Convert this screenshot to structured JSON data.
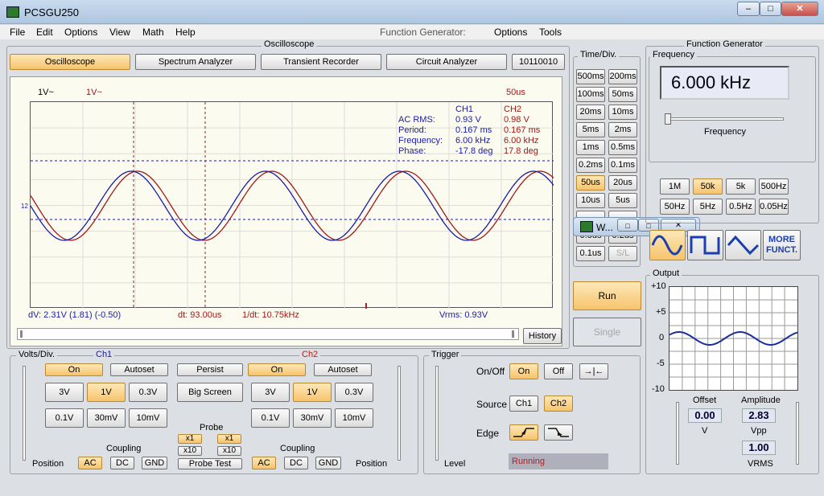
{
  "window": {
    "title": "PCSGU250",
    "minimize": "‒",
    "maximize": "□",
    "close": "✕"
  },
  "menu": {
    "file": "File",
    "edit": "Edit",
    "options": "Options",
    "view": "View",
    "math": "Math",
    "help": "Help",
    "fg_label": "Function Generator:",
    "fg_options": "Options",
    "fg_tools": "Tools"
  },
  "osc": {
    "section_title": "Oscilloscope",
    "tabs": [
      "Oscilloscope",
      "Spectrum Analyzer",
      "Transient Recorder",
      "Circuit Analyzer",
      "10110010"
    ]
  },
  "scope": {
    "ch1_scale": "1V~",
    "ch2_scale": "1V~",
    "timebase": "50us",
    "marker": "12",
    "meas_headers": [
      "CH1",
      "CH2"
    ],
    "meas": [
      {
        "label": "AC RMS:",
        "ch1": "0.93 V",
        "ch2": "0.98 V"
      },
      {
        "label": "Period:",
        "ch1": "0.167 ms",
        "ch2": "0.167 ms"
      },
      {
        "label": "Frequency:",
        "ch1": "6.00 kHz",
        "ch2": "6.00 kHz"
      },
      {
        "label": "Phase:",
        "ch1": "-17.8 deg",
        "ch2": "17.8 deg"
      }
    ],
    "dv": "dV: 2.31V  (1.81) (-0.50)",
    "dt": "dt: 93.00us",
    "inv_dt": "1/dt: 10.75kHz",
    "vrms": "Vrms: 0.93V",
    "history": "History",
    "colors": {
      "ch1": "#1a1aa8",
      "ch2": "#a01818"
    }
  },
  "timediv": {
    "title": "Time/Div.",
    "buttons": [
      [
        "500ms",
        "200ms"
      ],
      [
        "100ms",
        "50ms"
      ],
      [
        "20ms",
        "10ms"
      ],
      [
        "5ms",
        "2ms"
      ],
      [
        "1ms",
        "0.5ms"
      ],
      [
        "0.2ms",
        "0.1ms"
      ],
      [
        "50us",
        "20us"
      ],
      [
        "10us",
        "5us"
      ],
      [
        "",
        ""
      ],
      [
        "0.5us",
        "0.2us"
      ],
      [
        "0.1us",
        "S/L"
      ]
    ],
    "selected": "50us"
  },
  "run": "Run",
  "single": "Single",
  "mini_window": {
    "title": "W..."
  },
  "fg": {
    "title": "Function Generator",
    "freq_label": "Frequency",
    "freq_value": "6.000 kHz",
    "slider_label": "Frequency",
    "ranges": [
      "1M",
      "50k",
      "5k",
      "500Hz",
      "50Hz",
      "5Hz",
      "0.5Hz",
      "0.05Hz"
    ],
    "range_selected": "50k",
    "more": "MORE FUNCT.",
    "output_label": "Output",
    "y_ticks": [
      "+10",
      "+5",
      "0",
      "-5",
      "-10"
    ],
    "offset_label": "Offset",
    "offset_value": "0.00",
    "offset_unit": "V",
    "amp_label": "Amplitude",
    "amp_value": "2.83",
    "amp_unit": "Vpp",
    "vrms_value": "1.00",
    "vrms_unit": "VRMS"
  },
  "volts": {
    "title": "Volts/Div.",
    "ch1": "Ch1",
    "ch2": "Ch2",
    "on": "On",
    "autoset": "Autoset",
    "persist": "Persist",
    "big_screen": "Big Screen",
    "row1": [
      "3V",
      "1V",
      "0.3V"
    ],
    "row2": [
      "0.1V",
      "30mV",
      "10mV"
    ],
    "selected": "1V",
    "probe": "Probe",
    "x1": "x1",
    "x10": "x10",
    "probe_test": "Probe Test",
    "coupling": "Coupling",
    "ac": "AC",
    "dc": "DC",
    "gnd": "GND",
    "position": "Position"
  },
  "trigger": {
    "title": "Trigger",
    "onoff": "On/Off",
    "on": "On",
    "off": "Off",
    "source": "Source",
    "ch1": "Ch1",
    "ch2": "Ch2",
    "edge": "Edge",
    "level": "Level",
    "status": "Running"
  }
}
